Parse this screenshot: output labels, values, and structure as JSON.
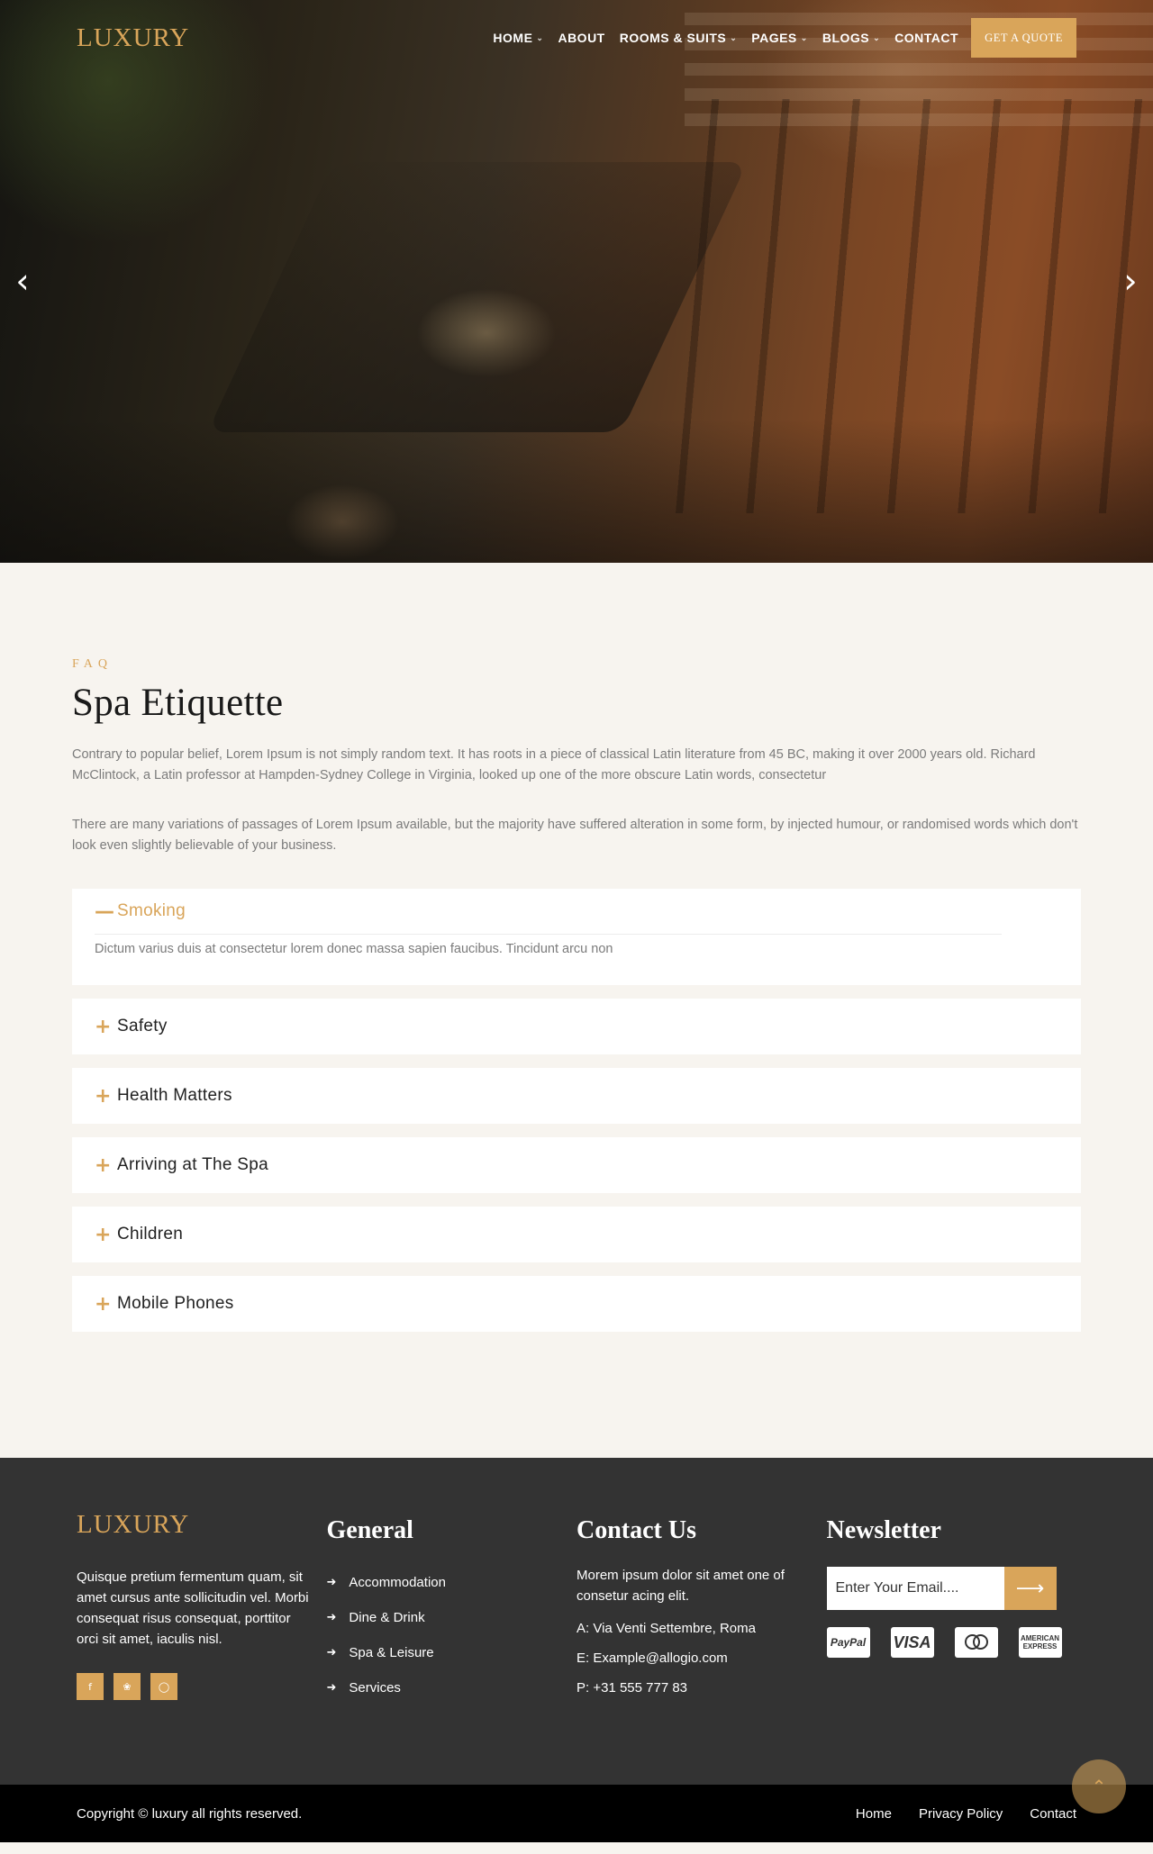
{
  "header": {
    "logo": "LUXURY",
    "nav": [
      {
        "label": "HOME",
        "dropdown": true
      },
      {
        "label": "ABOUT",
        "dropdown": false
      },
      {
        "label": "ROOMS & SUITS",
        "dropdown": true
      },
      {
        "label": "PAGES",
        "dropdown": true
      },
      {
        "label": "BLOGS",
        "dropdown": true
      },
      {
        "label": "CONTACT",
        "dropdown": false
      }
    ],
    "quote_button": "GET A QUOTE"
  },
  "hero": {
    "prev_icon": "‹",
    "next_icon": "›"
  },
  "faq": {
    "eyebrow": "FAQ",
    "title": "Spa Etiquette",
    "paragraph_1": "Contrary to popular belief, Lorem Ipsum is not simply random text. It has roots in a piece of classical Latin literature from 45 BC, making it over 2000 years old. Richard McClintock, a Latin professor at Hampden-Sydney College in Virginia, looked up one of the more obscure Latin words, consectetur",
    "paragraph_2": "There are many variations of passages of Lorem Ipsum available, but the majority have suffered alteration in some form, by injected humour, or randomised words which don't look even slightly believable of your business.",
    "items": [
      {
        "title": "Smoking",
        "open": true,
        "body": "Dictum varius duis at consectetur lorem donec massa sapien faucibus. Tincidunt arcu non"
      },
      {
        "title": "Safety",
        "open": false
      },
      {
        "title": "Health Matters",
        "open": false
      },
      {
        "title": "Arriving at The Spa",
        "open": false
      },
      {
        "title": "Children",
        "open": false
      },
      {
        "title": "Mobile Phones",
        "open": false
      }
    ]
  },
  "footer": {
    "logo": "LUXURY",
    "description": "Quisque pretium fermentum quam, sit amet cursus ante sollicitudin vel. Morbi consequat risus consequat, porttitor orci sit amet, iaculis nisl.",
    "socials": [
      "facebook-icon",
      "pinterest-icon",
      "instagram-icon"
    ],
    "general": {
      "heading": "General",
      "links": [
        "Accommodation",
        "Dine & Drink",
        "Spa & Leisure",
        "Services"
      ]
    },
    "contact": {
      "heading": "Contact Us",
      "text": "Morem ipsum dolor sit amet one of consetur acing elit.",
      "address": "A: Via Venti Settembre, Roma",
      "email": "E: Example@allogio.com",
      "phone": "P: +31 555 777 83"
    },
    "newsletter": {
      "heading": "Newsletter",
      "placeholder": "Enter Your Email....",
      "cards": [
        "PayPal",
        "VISA",
        "mastercard",
        "AMERICAN EXPRESS"
      ]
    },
    "copyright": "Copyright © luxury all rights reserved.",
    "bottom_links": [
      "Home",
      "Privacy Policy",
      "Contact"
    ]
  },
  "colors": {
    "accent": "#d9a55a",
    "background": "#f7f4ef",
    "footer": "#333333",
    "bottom_bar": "#000000"
  }
}
